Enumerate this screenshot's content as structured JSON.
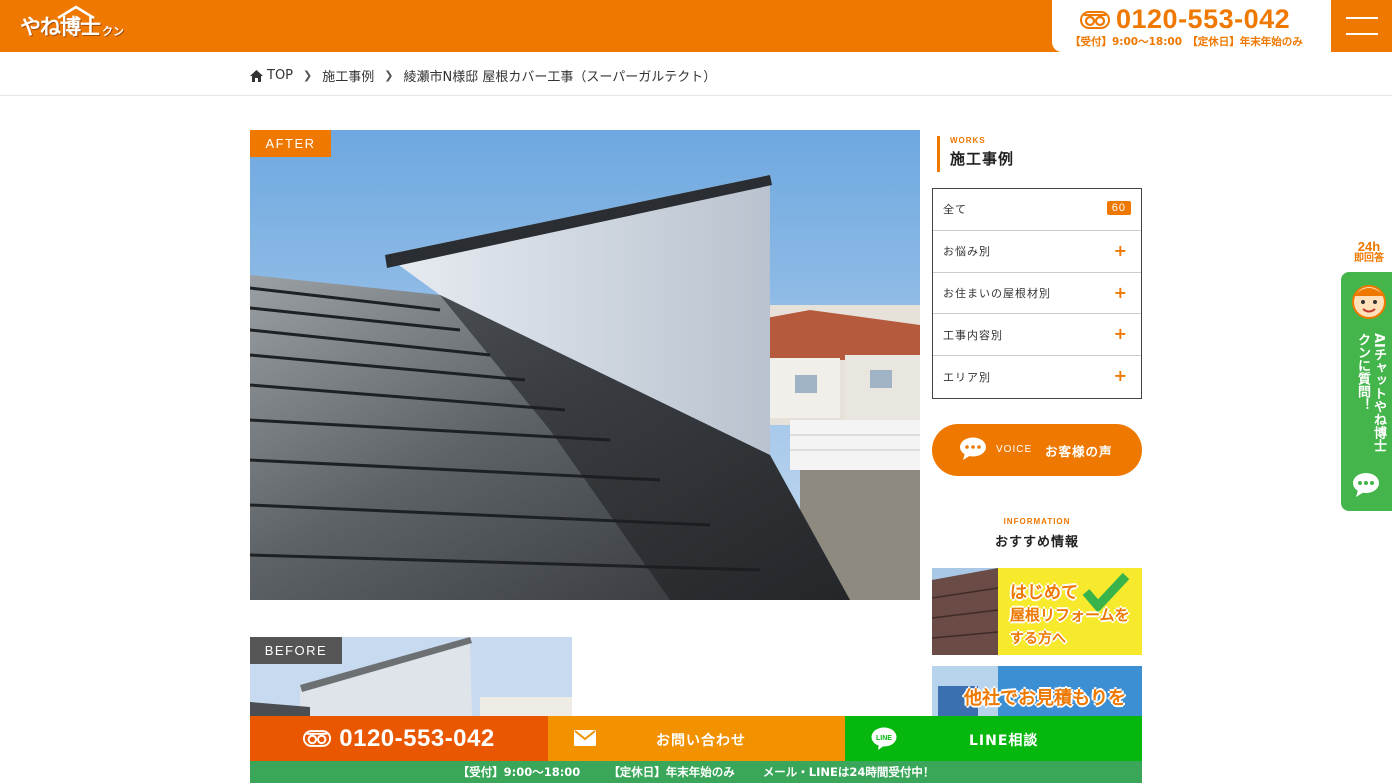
{
  "header": {
    "logo_text": "やね博士",
    "logo_sub": "クン",
    "tel_number": "0120-553-042",
    "tel_hours": "【受付】9:00〜18:00　【定休日】年末年始のみ",
    "menu_icon": "hamburger-icon"
  },
  "breadcrumb": {
    "home": "TOP",
    "items": [
      "施工事例",
      "綾瀬市N様邸 屋根カバー工事（スーパーガルテクト）"
    ]
  },
  "main": {
    "after_label": "AFTER",
    "before_label": "BEFORE"
  },
  "sidebar": {
    "works_en": "WORKS",
    "works_jp": "施工事例",
    "categories": [
      {
        "label": "全て",
        "count": "60"
      },
      {
        "label": "お悩み別"
      },
      {
        "label": "お住まいの屋根材別"
      },
      {
        "label": "工事内容別"
      },
      {
        "label": "エリア別"
      }
    ],
    "voice_en": "VOICE",
    "voice_jp": "お客様の声",
    "info_en": "INFORMATION",
    "info_jp": "おすすめ情報",
    "banner1_text": "はじめて屋根リフォームをする方へ",
    "banner1_line1": "はじめて",
    "banner1_line2": "屋根リフォームを",
    "banner1_line3": "する方へ",
    "banner2_text": "他社でお見積もりを"
  },
  "side_tab": {
    "badge_top": "24h",
    "badge_bottom": "即回答",
    "text": "AIチャットやね博士クンに質問！"
  },
  "bottom_bar": {
    "tel": "0120-553-042",
    "contact": "お問い合わせ",
    "line": "LINE相談",
    "note_hours": "【受付】9:00〜18:00",
    "note_holiday": "【定休日】年末年始のみ",
    "note_mail": "メール・LINEは24時間受付中！"
  },
  "colors": {
    "accent": "#ee7800",
    "line_green": "#06b80e",
    "note_green": "#3aa65a"
  }
}
